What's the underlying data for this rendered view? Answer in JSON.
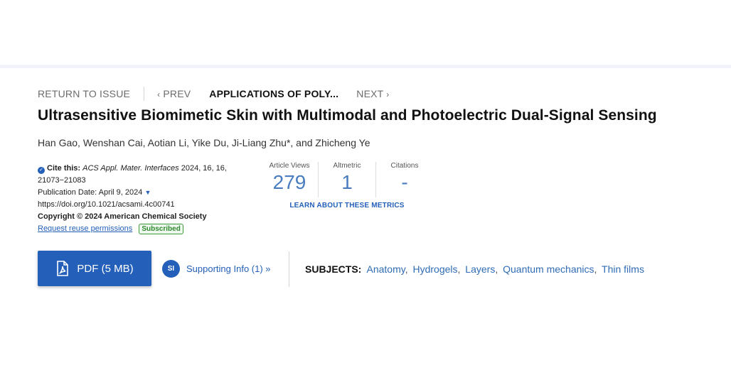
{
  "nav": {
    "return_label": "RETURN TO ISSUE",
    "prev_label": "PREV",
    "current_label": "APPLICATIONS OF POLY...",
    "next_label": "NEXT"
  },
  "article": {
    "title": "Ultrasensitive Biomimetic Skin with Multimodal and Photoelectric Dual-Signal Sensing",
    "authors": "Han Gao, Wenshan Cai, Aotian Li, Yike Du, Ji-Liang Zhu*, and Zhicheng Ye"
  },
  "citation": {
    "cite_label": "Cite this:",
    "journal": "ACS Appl. Mater. Interfaces",
    "details_line1": "2024, 16, 16,",
    "details_line2": "21073−21083",
    "pub_date": "Publication Date: April 9, 2024",
    "doi": "https://doi.org/10.1021/acsami.4c00741",
    "copyright": "Copyright © 2024 American Chemical Society",
    "reuse_link": "Request reuse permissions",
    "badge": "Subscribed"
  },
  "metrics": {
    "items": [
      {
        "label": "Article Views",
        "value": "279"
      },
      {
        "label": "Altmetric",
        "value": "1"
      },
      {
        "label": "Citations",
        "value": "-"
      }
    ],
    "learn_link": "LEARN ABOUT THESE METRICS"
  },
  "actions": {
    "pdf_label": "PDF (5 MB)",
    "si_badge": "SI",
    "si_label": "Supporting Info (1) »"
  },
  "subjects": {
    "label": "SUBJECTS:",
    "items": [
      "Anatomy",
      "Hydrogels",
      "Layers",
      "Quantum mechanics",
      "Thin films"
    ]
  },
  "colors": {
    "accent": "#2460b9",
    "metric_value": "#4a7cc0",
    "badge_green": "#2f8a2f"
  }
}
